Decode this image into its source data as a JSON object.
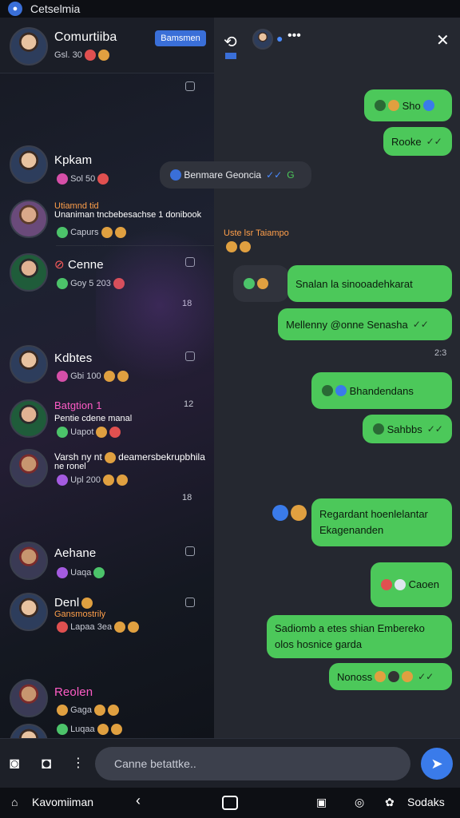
{
  "status": {
    "app_name": "Cetselmia"
  },
  "left": {
    "header": {
      "name": "Comurtiiba",
      "sub": "Gsl. 30",
      "button": "Bamsmen"
    },
    "chats": [
      {
        "name": "Kpkam",
        "sub": "Sol 50"
      },
      {
        "name": "Utiamnd tid",
        "line2": "Unaniman",
        "line3": "tncbebesachse 1 donibook",
        "sub": "Capurs"
      },
      {
        "name": "Cenne",
        "sub": "Goy 5 203",
        "time": "18"
      },
      {
        "name": "Kdbtes",
        "sub": "Gbi 100"
      },
      {
        "name": "Batgtion 1",
        "line2": "Pentie cdene manal",
        "sub": "Uapot",
        "time": "12"
      },
      {
        "name": "Varsh ny nt",
        "line2": "deamersbekrupbhila",
        "line3": "ne ronel",
        "sub": "Upl 200",
        "time": "18"
      },
      {
        "name": "Aehane",
        "sub": "Uaqa"
      },
      {
        "name": "Denl",
        "line2": "Gansmostrily",
        "sub": "Lapaa 3ea"
      },
      {
        "name": "Reolen",
        "sub": "Gaga"
      },
      {
        "name": "",
        "sub": "Luqaa"
      }
    ]
  },
  "right": {
    "messages": [
      {
        "text": "Sho"
      },
      {
        "text": "Rooke"
      },
      {
        "text": "Benmare Geoncia"
      },
      {
        "text": "Uste lsr Taiampo"
      },
      {
        "text": "Snalan la sinooadehkarat"
      },
      {
        "text": "Mellenny @onne Senasha"
      },
      {
        "text": "2:3"
      },
      {
        "text": "Bhandendans"
      },
      {
        "text": "Sahbbs"
      },
      {
        "text": "Regardant hoenlelantar Ekagenanden"
      },
      {
        "text": "Caoen"
      },
      {
        "text": "Sadiomb a etes shian Embereko olos hosnice garda"
      },
      {
        "text": "Nonoss"
      }
    ]
  },
  "composer": {
    "placeholder": "Canne betattke.."
  },
  "nav": {
    "left_label": "Kavomiiman",
    "right_label": "Sodaks"
  }
}
